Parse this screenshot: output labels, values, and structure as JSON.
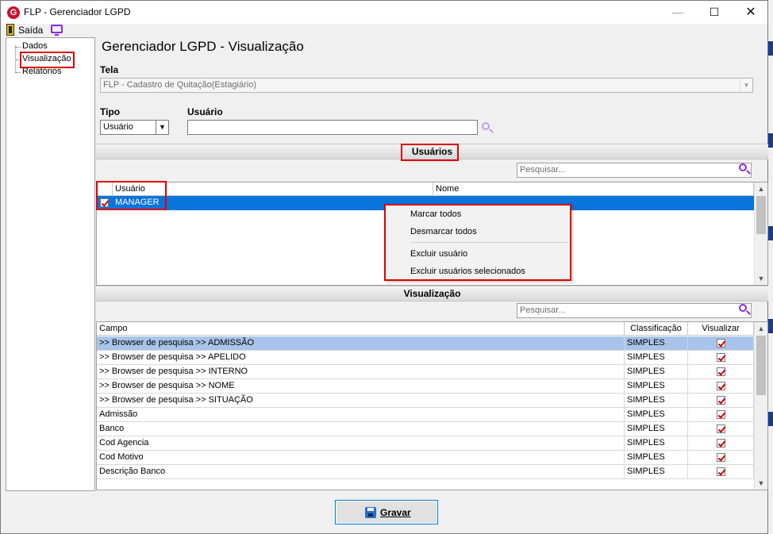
{
  "window": {
    "title": "FLP - Gerenciador LGPD",
    "logo_letter": "G"
  },
  "menubar": {
    "exit_label": "Saída"
  },
  "tree": {
    "items": [
      "Dados",
      "Visualização",
      "Relatórios"
    ]
  },
  "main": {
    "title": "Gerenciador LGPD - Visualização",
    "tela_label": "Tela",
    "tela_value": "FLP - Cadastro de Quitação(Estagiário)",
    "tipo_label": "Tipo",
    "tipo_value": "Usuário",
    "usuario_label": "Usuário",
    "usuario_value": ""
  },
  "users_section": {
    "header": "Usuários",
    "search_placeholder": "Pesquisar...",
    "columns": [
      "Usuário",
      "Nome"
    ],
    "rows": [
      {
        "usuario": "MANAGER",
        "nome": "",
        "checked": true
      }
    ]
  },
  "context_menu": {
    "items": [
      "Marcar todos",
      "Desmarcar todos",
      "Excluir usuário",
      "Excluir usuários selecionados"
    ]
  },
  "fields_section": {
    "header": "Visualização",
    "search_placeholder": "Pesquisar...",
    "columns": [
      "Campo",
      "Classificação",
      "Visualizar"
    ],
    "rows": [
      {
        "campo": ">> Browser de pesquisa >> ADMISSÃO",
        "classificacao": "SIMPLES",
        "visualizar": true
      },
      {
        "campo": ">> Browser de pesquisa >> APELIDO",
        "classificacao": "SIMPLES",
        "visualizar": true
      },
      {
        "campo": ">> Browser de pesquisa >> INTERNO",
        "classificacao": "SIMPLES",
        "visualizar": true
      },
      {
        "campo": ">> Browser de pesquisa >> NOME",
        "classificacao": "SIMPLES",
        "visualizar": true
      },
      {
        "campo": ">> Browser de pesquisa >> SITUAÇÃO",
        "classificacao": "SIMPLES",
        "visualizar": true
      },
      {
        "campo": "Admissão",
        "classificacao": "SIMPLES",
        "visualizar": true
      },
      {
        "campo": "Banco",
        "classificacao": "SIMPLES",
        "visualizar": true
      },
      {
        "campo": "Cod Agencia",
        "classificacao": "SIMPLES",
        "visualizar": true
      },
      {
        "campo": "Cod Motivo",
        "classificacao": "SIMPLES",
        "visualizar": true
      },
      {
        "campo": "Descrição Banco",
        "classificacao": "SIMPLES",
        "visualizar": true
      }
    ]
  },
  "footer": {
    "save_label": "Gravar"
  },
  "colors": {
    "selection_blue": "#0a74da",
    "row_selected": "#a9c4ea",
    "highlight_red": "#e00000",
    "icon_purple": "#8a2be2"
  }
}
